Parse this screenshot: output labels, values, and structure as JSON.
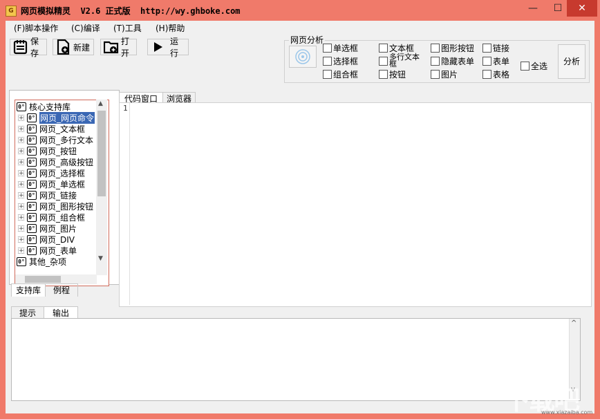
{
  "window": {
    "title": "网页模拟精灵  V2.6 正式版  http://wy.ghboke.com",
    "app_icon_letter": "G",
    "buttons": {
      "minimize": "—",
      "maximize": "☐",
      "close": "✕"
    }
  },
  "menu": [
    {
      "label": "(F)脚本操作"
    },
    {
      "label": "(C)编译"
    },
    {
      "label": "(T)工具"
    },
    {
      "label": "(H)帮助"
    }
  ],
  "toolbar": {
    "save": "保存",
    "new": "新建",
    "open": "打开",
    "run": "运行"
  },
  "analysis": {
    "group_label": "网页分析",
    "checkboxes": {
      "radio": "单选框",
      "select": "选择框",
      "combo": "组合框",
      "textbox": "文本框",
      "multiline": "多行文本框",
      "button": "按钮",
      "image_button": "图形按钮",
      "hidden_form": "隐藏表单",
      "image": "图片",
      "link": "链接",
      "form": "表单",
      "table": "表格",
      "select_all": "全选"
    },
    "analyze_button": "分析"
  },
  "tree": {
    "icon_text": "0°",
    "root": "核心支持库",
    "items": [
      "网页_网页命令",
      "网页_文本框",
      "网页_多行文本",
      "网页_按钮",
      "网页_高级按钮",
      "网页_选择框",
      "网页_单选框",
      "网页_链接",
      "网页_图形按钮",
      "网页_组合框",
      "网页_图片",
      "网页_DIV",
      "网页_表单"
    ],
    "other": "其他_杂项",
    "selected_index": 0
  },
  "left_tabs": {
    "library": "支持库",
    "examples": "例程"
  },
  "editor_tabs": {
    "code": "代码窗口",
    "browser": "浏览器"
  },
  "editor": {
    "line_number": "1"
  },
  "bottom_tabs": {
    "hint": "提示",
    "output": "输出"
  },
  "watermark": {
    "text": "下载吧",
    "url": "www.xiazaiba.com"
  }
}
